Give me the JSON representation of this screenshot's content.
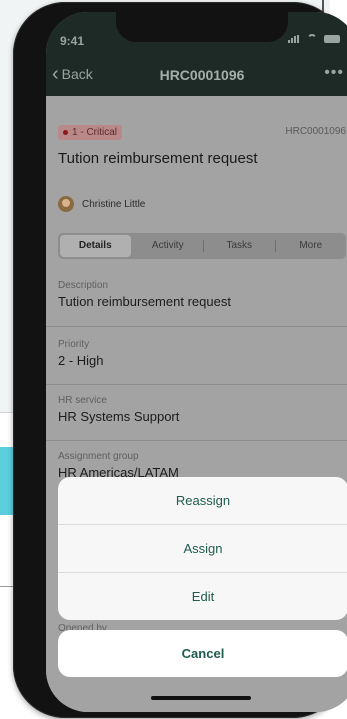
{
  "status_bar": {
    "time": "9:41"
  },
  "header": {
    "back_label": "Back",
    "title": "HRC0001096",
    "more_label": "•••"
  },
  "record": {
    "priority_badge": "1 - Critical",
    "number": "HRC0001096",
    "title": "Tution reimbursement request",
    "assignee": "Christine Little"
  },
  "tabs": [
    "Details",
    "Activity",
    "Tasks",
    "More"
  ],
  "fields": [
    {
      "label": "Description",
      "value": "Tution reimbursement request"
    },
    {
      "label": "Priority",
      "value": "2 - High"
    },
    {
      "label": "HR service",
      "value": "HR Systems Support"
    },
    {
      "label": "Assignment group",
      "value": "HR Americas/LATAM"
    },
    {
      "label": "Opened by",
      "value": ""
    }
  ],
  "action_sheet": {
    "actions": [
      "Reassign",
      "Assign",
      "Edit"
    ],
    "cancel_label": "Cancel"
  },
  "colors": {
    "accent": "#1f5a4c",
    "critical": "#8b1a1a"
  }
}
